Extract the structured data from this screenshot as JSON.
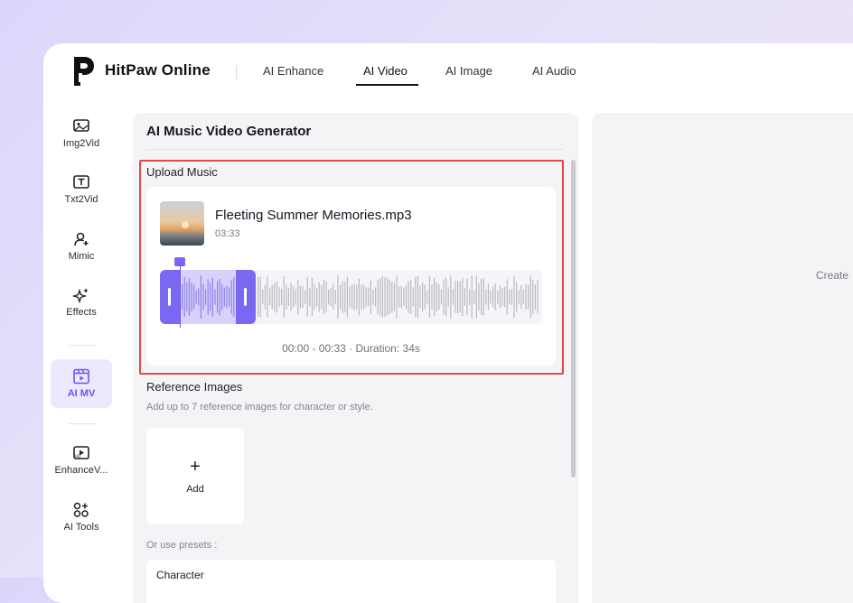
{
  "brand": {
    "name": "HitPaw Online"
  },
  "nav": {
    "tabs": [
      {
        "label": "AI Enhance"
      },
      {
        "label": "AI Video"
      },
      {
        "label": "AI Image"
      },
      {
        "label": "AI Audio"
      }
    ],
    "active": "AI Video"
  },
  "sidebar": {
    "items": [
      {
        "label": "Img2Vid",
        "icon": "image-to-video-icon"
      },
      {
        "label": "Txt2Vid",
        "icon": "text-to-video-icon"
      },
      {
        "label": "Mimic",
        "icon": "person-plus-icon"
      },
      {
        "label": "Effects",
        "icon": "sparkle-icon"
      },
      {
        "label": "AI MV",
        "icon": "music-video-icon"
      },
      {
        "label": "EnhanceV...",
        "icon": "video-enhance-icon"
      },
      {
        "label": "AI Tools",
        "icon": "apps-grid-icon"
      }
    ],
    "active": "AI MV",
    "accent": "#6b57f0"
  },
  "main": {
    "title": "AI Music Video Generator",
    "upload": {
      "label": "Upload Music",
      "file_name": "Fleeting Summer Memories.mp3",
      "file_duration": "03:33",
      "range": "00:00 - 00:33 · Duration: 34s"
    },
    "reference": {
      "label": "Reference Images",
      "subtitle": "Add up to 7 reference images for character or style.",
      "add_label": "Add",
      "add_symbol": "+",
      "presets_label": "Or use presets :",
      "character_label": "Character"
    }
  },
  "right_panel": {
    "text": "Create"
  },
  "colors": {
    "accent": "#7b68f2",
    "highlight": "#e04b4b"
  }
}
